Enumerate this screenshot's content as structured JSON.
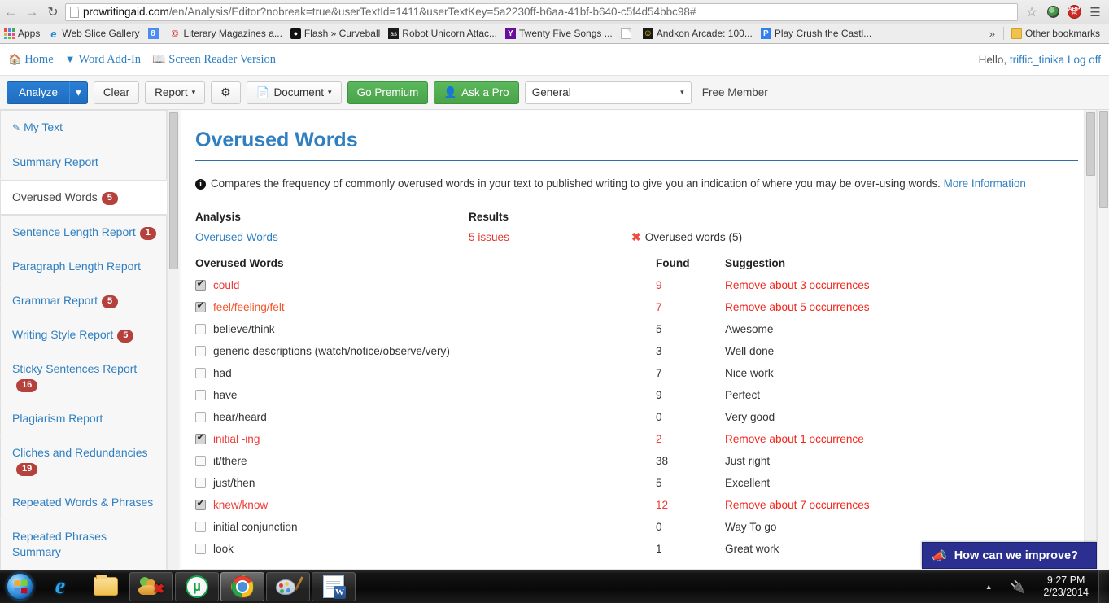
{
  "browser": {
    "back_icon": "back-arrow-icon",
    "forward_icon": "forward-arrow-icon",
    "reload_icon": "reload-icon",
    "url_host": "prowritingaid.com",
    "url_path": "/en/Analysis/Editor?nobreak=true&userTextId=1411&userTextKey=5a2230ff-b6aa-41bf-b640-c5f4d54bbc98#",
    "star_icon": "star-icon",
    "extension_globe": "globe-extension-icon",
    "adblock_label": "ABP",
    "adblock_count": "25",
    "menu_icon": "hamburger-menu-icon",
    "bookmarks": [
      {
        "label": "Apps",
        "icon": "apps-grid-icon"
      },
      {
        "label": "Web Slice Gallery",
        "icon": "ie-icon"
      },
      {
        "label": "",
        "icon": "google-icon"
      },
      {
        "label": "Literary Magazines a...",
        "icon": "c-circle-icon"
      },
      {
        "label": "Flash » Curveball",
        "icon": "flash-icon"
      },
      {
        "label": "Robot Unicorn Attac...",
        "icon": "as-icon"
      },
      {
        "label": "Twenty Five Songs ...",
        "icon": "yahoo-icon"
      },
      {
        "label": "",
        "icon": "blank-page-icon"
      },
      {
        "label": "Andkon Arcade: 100...",
        "icon": "andkon-icon"
      },
      {
        "label": "Play Crush the Castl...",
        "icon": "p-icon"
      }
    ],
    "overflow_label": "»",
    "other_bookmarks": "Other bookmarks"
  },
  "site_header": {
    "nav": [
      {
        "label": "Home",
        "icon": "home-icon"
      },
      {
        "label": "Word Add-In",
        "icon": "download-circle-icon"
      },
      {
        "label": "Screen Reader Version",
        "icon": "book-icon"
      }
    ],
    "greeting": "Hello,",
    "username": "triffic_tinika",
    "logoff": "Log off"
  },
  "toolbar": {
    "analyze": "Analyze",
    "analyze_caret": "▾",
    "clear": "Clear",
    "report": "Report",
    "report_caret": "▾",
    "settings_icon": "gear-icon",
    "document": "Document",
    "document_caret": "▾",
    "document_icon": "document-page-icon",
    "go_premium": "Go Premium",
    "ask_a_pro": "Ask a Pro",
    "ask_a_pro_icon": "user-icon",
    "style_select": "General",
    "style_select_caret": "▾",
    "membership": "Free Member"
  },
  "sidebar": {
    "items": [
      {
        "label": "My Text",
        "badge": "",
        "icon": "edit-pencil-icon",
        "active": false
      },
      {
        "label": "Summary Report",
        "badge": "",
        "active": false
      },
      {
        "label": "Overused Words",
        "badge": "5",
        "active": true
      },
      {
        "label": "Sentence Length Report",
        "badge": "1",
        "active": false
      },
      {
        "label": "Paragraph Length Report",
        "badge": "",
        "active": false
      },
      {
        "label": "Grammar Report",
        "badge": "5",
        "active": false
      },
      {
        "label": "Writing Style Report",
        "badge": "5",
        "active": false
      },
      {
        "label": "Sticky Sentences Report",
        "badge": "16",
        "active": false
      },
      {
        "label": "Plagiarism Report",
        "badge": "",
        "active": false
      },
      {
        "label": "Cliches and Redundancies",
        "badge": "19",
        "active": false
      },
      {
        "label": "Repeated Words & Phrases",
        "badge": "",
        "active": false
      },
      {
        "label": "Repeated Phrases Summary",
        "badge": "",
        "active": false
      }
    ]
  },
  "main": {
    "title": "Overused Words",
    "description": "Compares the frequency of commonly overused words in your text to published writing to give you an indication of where you may be over-using words.",
    "more_information": "More Information",
    "info_icon": "info-icon",
    "summary": {
      "head_analysis": "Analysis",
      "head_results": "Results",
      "analysis_link": "Overused Words",
      "results_value": "5 issues",
      "status_icon": "red-x-icon",
      "status_text": "Overused words (5)"
    },
    "table": {
      "headers": [
        "Overused Words",
        "Found",
        "Suggestion"
      ],
      "rows": [
        {
          "word": "could",
          "checked": true,
          "found": "9",
          "suggestion": "Remove about 3 occurrences",
          "highlight": "red"
        },
        {
          "word": "feel/feeling/felt",
          "checked": true,
          "found": "7",
          "suggestion": "Remove about 5 occurrences",
          "highlight": "orange"
        },
        {
          "word": "believe/think",
          "checked": false,
          "found": "5",
          "suggestion": "Awesome",
          "highlight": "none"
        },
        {
          "word": "generic descriptions (watch/notice/observe/very)",
          "checked": false,
          "found": "3",
          "suggestion": "Well done",
          "highlight": "none"
        },
        {
          "word": "had",
          "checked": false,
          "found": "7",
          "suggestion": "Nice work",
          "highlight": "none"
        },
        {
          "word": "have",
          "checked": false,
          "found": "9",
          "suggestion": "Perfect",
          "highlight": "none"
        },
        {
          "word": "hear/heard",
          "checked": false,
          "found": "0",
          "suggestion": "Very good",
          "highlight": "none"
        },
        {
          "word": "initial -ing",
          "checked": true,
          "found": "2",
          "suggestion": "Remove about 1 occurrence",
          "highlight": "red"
        },
        {
          "word": "it/there",
          "checked": false,
          "found": "38",
          "suggestion": "Just right",
          "highlight": "none"
        },
        {
          "word": "just/then",
          "checked": false,
          "found": "5",
          "suggestion": "Excellent",
          "highlight": "none"
        },
        {
          "word": "knew/know",
          "checked": true,
          "found": "12",
          "suggestion": "Remove about 7 occurrences",
          "highlight": "red"
        },
        {
          "word": "initial conjunction",
          "checked": false,
          "found": "0",
          "suggestion": "Way To go",
          "highlight": "none"
        },
        {
          "word": "look",
          "checked": false,
          "found": "1",
          "suggestion": "Great work",
          "highlight": "none"
        }
      ]
    }
  },
  "feedback": {
    "label": "How can we improve?",
    "icon": "megaphone-icon"
  },
  "taskbar": {
    "start_icon": "windows-start-orb-icon",
    "items": [
      {
        "name": "internet-explorer",
        "icon": "ie-icon",
        "state": "pinned"
      },
      {
        "name": "file-explorer",
        "icon": "folder-icon",
        "state": "pinned"
      },
      {
        "name": "windows-live-messenger",
        "icon": "messenger-icon",
        "state": "running"
      },
      {
        "name": "utorrent",
        "icon": "utorrent-icon",
        "state": "running"
      },
      {
        "name": "google-chrome",
        "icon": "chrome-icon",
        "state": "active"
      },
      {
        "name": "paint",
        "icon": "paint-palette-icon",
        "state": "running"
      },
      {
        "name": "microsoft-word",
        "icon": "word-icon",
        "state": "running"
      }
    ],
    "tray_arrow": "▲",
    "tray_icon": "unplug-device-icon",
    "time": "9:27 PM",
    "date": "2/23/2014"
  },
  "colors": {
    "accent_blue": "#2f7fc1",
    "primary_button": "#1f6dbf",
    "green_button": "#49a349",
    "badge_red": "#b5413c",
    "alert_red": "#ef3b36",
    "feedback_navy": "#2b2f8f"
  }
}
